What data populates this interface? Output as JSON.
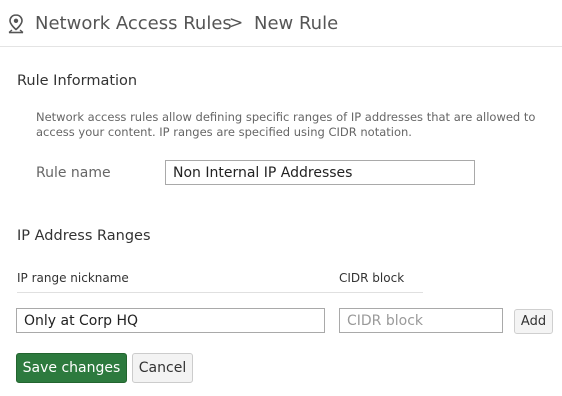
{
  "breadcrumb": {
    "root": "Network Access Rules",
    "separator": ">",
    "current": "New Rule"
  },
  "rule_info": {
    "title": "Rule Information",
    "description": "Network access rules allow defining specific ranges of IP addresses that are allowed to access your content. IP ranges are specified using CIDR notation.",
    "rule_name_label": "Rule name",
    "rule_name_value": "Non Internal IP Addresses"
  },
  "ip_ranges": {
    "title": "IP Address Ranges",
    "columns": [
      "IP range nickname",
      "CIDR block"
    ],
    "nickname_value": "Only at Corp HQ",
    "cidr_placeholder": "CIDR block",
    "add_label": "Add"
  },
  "actions": {
    "save_label": "Save changes",
    "cancel_label": "Cancel"
  },
  "colors": {
    "primary_button": "#2d7a3e",
    "icon": "#555555"
  }
}
